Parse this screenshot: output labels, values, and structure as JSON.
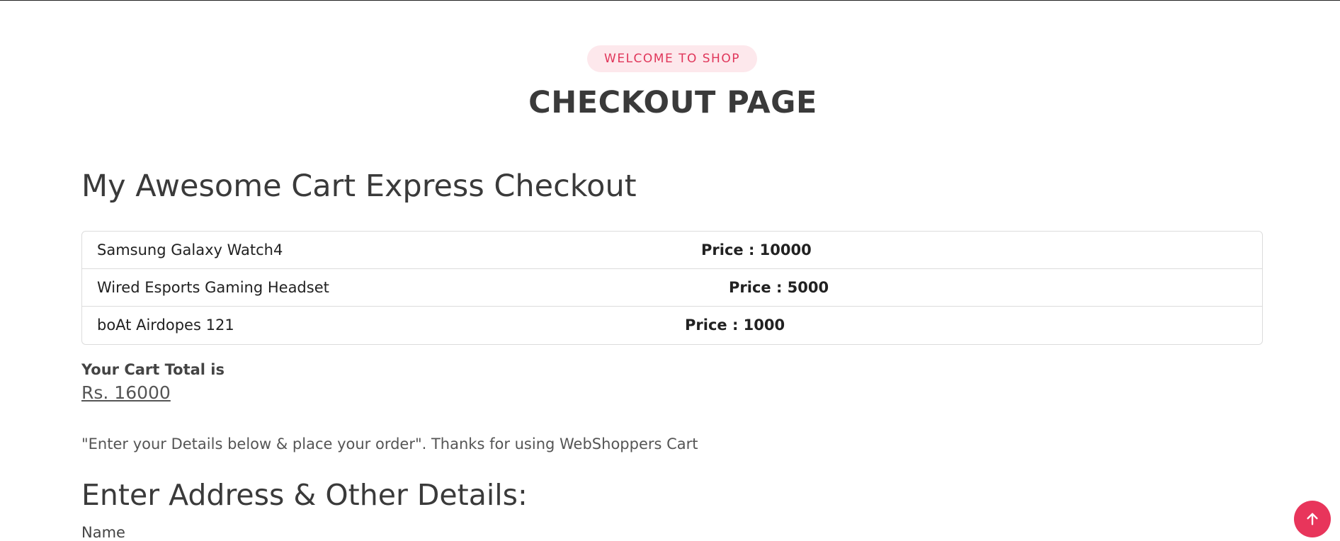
{
  "header": {
    "badge": "WELCOME TO SHOP",
    "title": "CHECKOUT PAGE"
  },
  "cart": {
    "heading": "My Awesome Cart Express Checkout",
    "items": [
      {
        "name": "Samsung Galaxy Watch4",
        "price": "Price : 10000"
      },
      {
        "name": "Wired Esports Gaming Headset",
        "price": "Price : 5000"
      },
      {
        "name": "boAt Airdopes 121",
        "price": "Price : 1000"
      }
    ],
    "total_label": "Your Cart Total is",
    "total_value": "Rs. 16000"
  },
  "note": "\"Enter your Details below & place your order\". Thanks for using WebShoppers Cart",
  "form": {
    "heading": "Enter Address & Other Details:",
    "name_label": "Name"
  },
  "colors": {
    "accent": "#e8355b",
    "badge_bg": "#fde8ec"
  },
  "icons": {
    "scroll_top": "arrow-up-icon"
  }
}
